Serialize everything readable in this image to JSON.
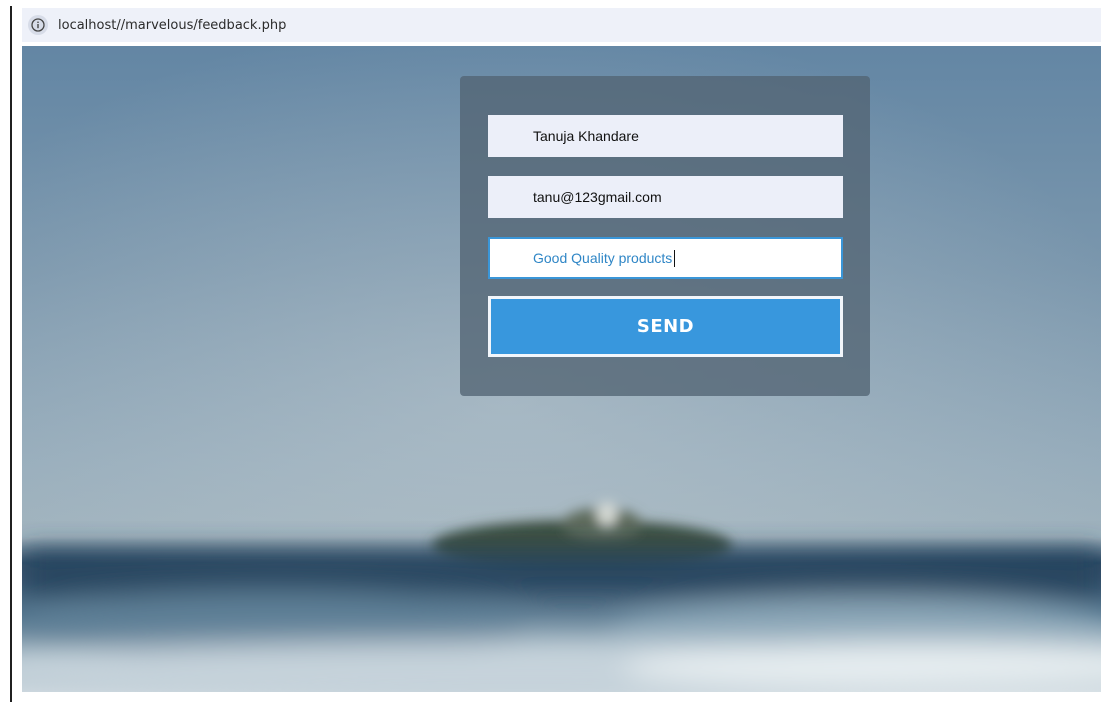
{
  "browser": {
    "url": "localhost//marvelous/feedback.php",
    "icon": "info-icon"
  },
  "form": {
    "name_value": "Tanuja Khandare",
    "email_value": "tanu@123gmail.com",
    "feedback_value": "Good Quality products",
    "send_label": "SEND"
  },
  "colors": {
    "panel": "#526473",
    "input_bg": "#eceff9",
    "focus_border": "#3a96d8",
    "button": "#3897dd"
  }
}
